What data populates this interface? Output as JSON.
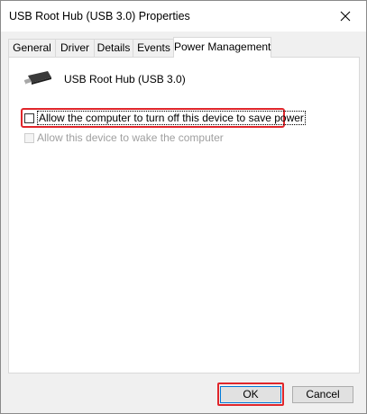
{
  "window": {
    "title": "USB Root Hub (USB 3.0) Properties",
    "close_icon": "close-icon"
  },
  "tabs": [
    {
      "label": "General",
      "active": false
    },
    {
      "label": "Driver",
      "active": false
    },
    {
      "label": "Details",
      "active": false
    },
    {
      "label": "Events",
      "active": false
    },
    {
      "label": "Power Management",
      "active": true
    }
  ],
  "panel": {
    "device_icon": "usb-plug-icon",
    "device_name": "USB Root Hub (USB 3.0)",
    "options": [
      {
        "label": "Allow the computer to turn off this device to save power",
        "checked": false,
        "enabled": true,
        "highlighted": true
      },
      {
        "label": "Allow this device to wake the computer",
        "checked": false,
        "enabled": false
      }
    ]
  },
  "buttons": {
    "ok": "OK",
    "cancel": "Cancel"
  },
  "colors": {
    "highlight": "#e0262b",
    "accent": "#0078d7",
    "disabled_text": "#a0a0a0"
  }
}
